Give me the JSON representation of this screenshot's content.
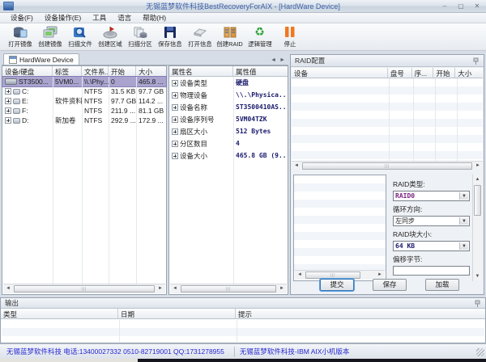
{
  "window": {
    "title": "无锡蓝梦软件科技BestRecoveryForAIX - [HardWare Device]",
    "controls": {
      "minimize": "–",
      "maximize": "▢",
      "close": "✕"
    }
  },
  "menu": {
    "items": [
      {
        "label": "设备(F)"
      },
      {
        "label": "设备操作(E)"
      },
      {
        "label": "工具"
      },
      {
        "label": "语言"
      },
      {
        "label": "帮助(H)"
      }
    ]
  },
  "toolbar": {
    "buttons": [
      {
        "label": "打开镜像",
        "icon": "open-image-icon"
      },
      {
        "label": "创建镜像",
        "icon": "create-image-icon"
      },
      {
        "label": "扫描文件",
        "icon": "scan-files-icon"
      },
      {
        "label": "创建区域",
        "icon": "create-region-icon"
      },
      {
        "label": "扫描分区",
        "icon": "scan-partition-icon"
      },
      {
        "label": "保存信息",
        "icon": "save-info-icon"
      },
      {
        "label": "打开信息",
        "icon": "open-info-icon"
      },
      {
        "label": "创建RAID",
        "icon": "create-raid-icon"
      },
      {
        "label": "逻辑管理",
        "icon": "logic-manage-icon"
      },
      {
        "label": "停止",
        "icon": "stop-icon"
      }
    ]
  },
  "device_panel": {
    "tab": "HardWare Device",
    "columns": [
      "设备/硬盘",
      "标签",
      "文件系...",
      "开始",
      "大小"
    ],
    "rows": [
      {
        "device": "ST3500...",
        "label": "5VM0...",
        "fs": "\\\\.\\Phy...",
        "start": "0",
        "size": "465.8 ..."
      },
      {
        "device": "C:",
        "label": "",
        "fs": "NTFS",
        "start": "31.5 KB",
        "size": "97.7 GB"
      },
      {
        "device": "E:",
        "label": "软件资料",
        "fs": "NTFS",
        "start": "97.7 GB",
        "size": "114.2 ..."
      },
      {
        "device": "F:",
        "label": "",
        "fs": "NTFS",
        "start": "211.9 ...",
        "size": "81.1 GB"
      },
      {
        "device": "D:",
        "label": "新加卷",
        "fs": "NTFS",
        "start": "292.9 ...",
        "size": "172.9 ..."
      }
    ]
  },
  "property_panel": {
    "columns": [
      "属性名",
      "属性值"
    ],
    "rows": [
      {
        "name": "设备类型",
        "value": "硬盘"
      },
      {
        "name": "物理设备",
        "value": "\\\\.\\Physica..."
      },
      {
        "name": "设备名称",
        "value": "ST3500410AS..."
      },
      {
        "name": "设备序列号",
        "value": "5VM04TZK"
      },
      {
        "name": "扇区大小",
        "value": "512 Bytes"
      },
      {
        "name": "分区数目",
        "value": "4"
      },
      {
        "name": "设备大小",
        "value": "465.8 GB (9..."
      }
    ]
  },
  "raid_panel": {
    "title": "RAID配置",
    "columns": [
      "设备",
      "盘号",
      "序...",
      "开始",
      "大小"
    ],
    "form": {
      "raid_type_label": "RAID类型:",
      "raid_type_value": "RAID0",
      "direction_label": "循环方向:",
      "direction_value": "左同步",
      "block_label": "RAID块大小:",
      "block_value": "64 KB",
      "offset_label": "偏移字节:"
    },
    "buttons": {
      "submit": "提交",
      "save": "保存",
      "load": "加载"
    }
  },
  "output_panel": {
    "title": "输出",
    "columns": [
      "类型",
      "日期",
      "提示"
    ]
  },
  "status_bar": {
    "left": "无锡蓝梦软件科技 电话:13400027332 0510-82719001 QQ:1731278955",
    "right": "无锡蓝梦软件科技-IBM AIX小机版本"
  },
  "scroll": {
    "left": "◄",
    "right": "►",
    "up": "▲",
    "down": "▼",
    "grip": "|||",
    "drop": "▼"
  }
}
